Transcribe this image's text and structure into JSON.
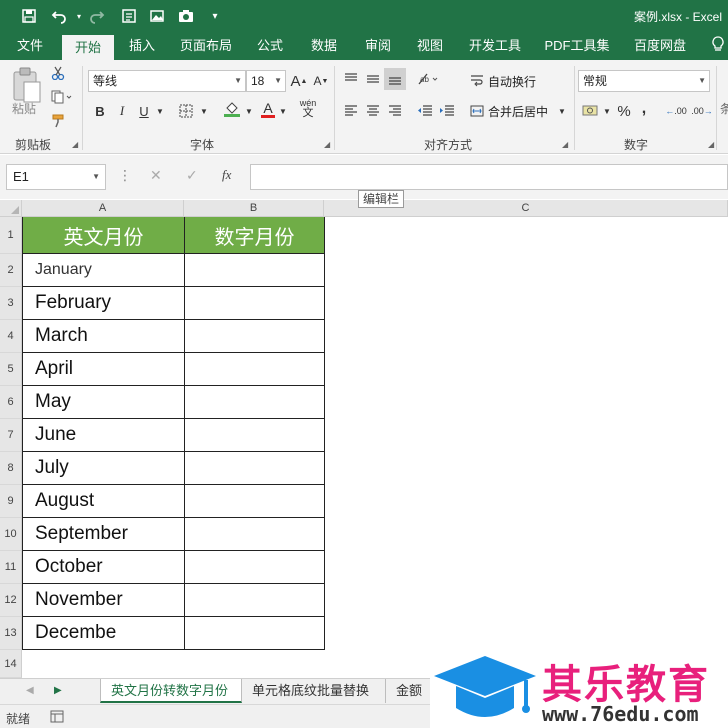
{
  "titlebar": {
    "document_title": "案例.xlsx - Excel",
    "qa_icons": [
      "save-icon",
      "undo-icon",
      "redo-icon",
      "form-icon",
      "picture-icon",
      "camera-icon",
      "customize-icon"
    ]
  },
  "ribbon_tabs": [
    "文件",
    "开始",
    "插入",
    "页面布局",
    "公式",
    "数据",
    "审阅",
    "视图",
    "开发工具",
    "PDF工具集",
    "百度网盘"
  ],
  "active_tab": "开始",
  "ribbon": {
    "clipboard": {
      "label": "剪贴板",
      "paste": "粘贴"
    },
    "font": {
      "label": "字体",
      "font_name": "等线",
      "font_size": "18",
      "bold": "B",
      "italic": "I",
      "underline": "U",
      "grow": "A",
      "shrink": "A",
      "font_color": "A",
      "phonetic": "wén"
    },
    "alignment": {
      "label": "对齐方式",
      "wrap_text": "自动换行",
      "merge_center": "合并后居中"
    },
    "number": {
      "label": "数字",
      "format": "常规",
      "percent": "%",
      "comma": ",",
      "inc_decimal": ".00",
      "dec_decimal": ".00"
    }
  },
  "formula_bar": {
    "name_box": "E1",
    "cancel": "✕",
    "enter": "✓",
    "fx": "fx",
    "value": "",
    "tooltip": "编辑栏"
  },
  "columns": [
    "A",
    "B",
    "C"
  ],
  "rows": [
    "1",
    "2",
    "3",
    "4",
    "5",
    "6",
    "7",
    "8",
    "9",
    "10",
    "11",
    "12",
    "13",
    "14"
  ],
  "table": {
    "header": [
      "英文月份",
      "数字月份"
    ],
    "months": [
      "January",
      "February",
      "March",
      "April",
      "May",
      "June",
      "July",
      "August",
      "September",
      "October",
      "November",
      "Decembe"
    ],
    "header_color": "#70ad47"
  },
  "sheets": [
    "英文月份转数字月份",
    "单元格底纹批量替换",
    "金额"
  ],
  "active_sheet": "英文月份转数字月份",
  "status": {
    "ready": "就绪"
  },
  "watermark": {
    "brand": "其乐教育",
    "url": "www.76edu.com",
    "brand_color": "#e8207c",
    "logo_color": "#1a8fe3"
  },
  "colors": {
    "excel_green": "#217346"
  }
}
